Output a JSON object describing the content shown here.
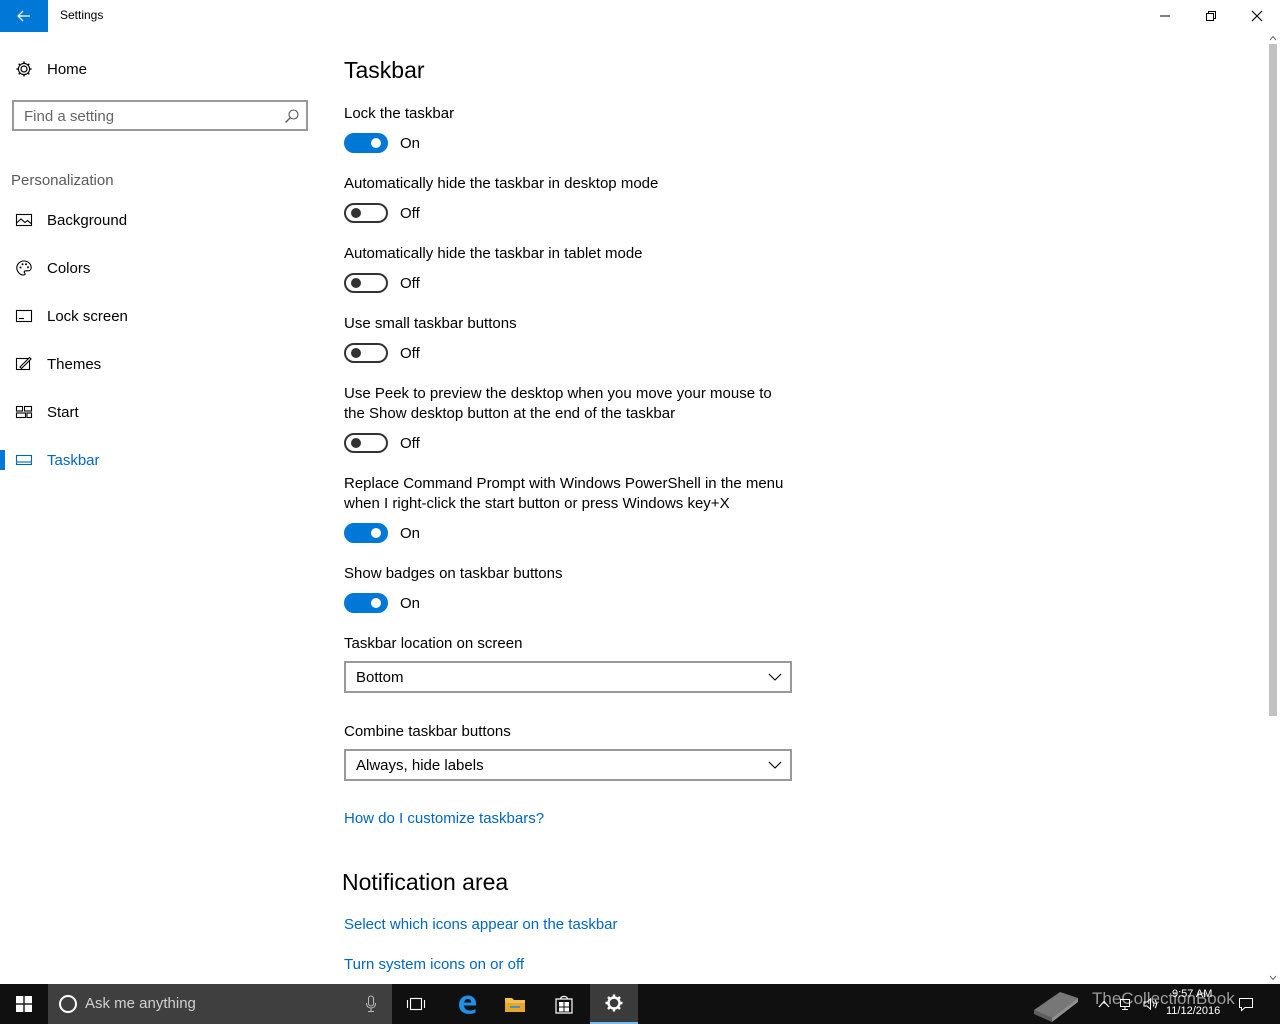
{
  "window": {
    "title": "Settings",
    "controls": [
      "minimize-icon",
      "restore-icon",
      "close-icon"
    ]
  },
  "sidebar": {
    "home_label": "Home",
    "search_placeholder": "Find a setting",
    "section_heading": "Personalization",
    "items": [
      {
        "label": "Background",
        "icon": "picture-icon",
        "active": false
      },
      {
        "label": "Colors",
        "icon": "palette-icon",
        "active": false
      },
      {
        "label": "Lock screen",
        "icon": "lock-screen-icon",
        "active": false
      },
      {
        "label": "Themes",
        "icon": "brush-icon",
        "active": false
      },
      {
        "label": "Start",
        "icon": "start-tiles-icon",
        "active": false
      },
      {
        "label": "Taskbar",
        "icon": "taskbar-icon",
        "active": true
      }
    ]
  },
  "main": {
    "title": "Taskbar",
    "options": [
      {
        "label": "Lock the taskbar",
        "state": "On",
        "on": true
      },
      {
        "label": "Automatically hide the taskbar in desktop mode",
        "state": "Off",
        "on": false
      },
      {
        "label": "Automatically hide the taskbar in tablet mode",
        "state": "Off",
        "on": false
      },
      {
        "label": "Use small taskbar buttons",
        "state": "Off",
        "on": false
      },
      {
        "label": "Use Peek to preview the desktop when you move your mouse to the Show desktop button at the end of the taskbar",
        "state": "Off",
        "on": false
      },
      {
        "label": "Replace Command Prompt with Windows PowerShell in the menu when I right-click the start button or press Windows key+X",
        "state": "On",
        "on": true
      },
      {
        "label": "Show badges on taskbar buttons",
        "state": "On",
        "on": true
      }
    ],
    "location": {
      "label": "Taskbar location on screen",
      "value": "Bottom"
    },
    "combine": {
      "label": "Combine taskbar buttons",
      "value": "Always, hide labels"
    },
    "help_link": "How do I customize taskbars?",
    "notification": {
      "title": "Notification area",
      "link1": "Select which icons appear on the taskbar",
      "link2": "Turn system icons on or off"
    }
  },
  "taskbar": {
    "search_placeholder": "Ask me anything",
    "apps": [
      "task-view-icon",
      "edge-icon",
      "file-explorer-icon",
      "store-icon",
      "settings-gear-icon"
    ],
    "watermark": "TheCollectionBook",
    "time": "9:57 AM",
    "date": "11/12/2016"
  },
  "colors": {
    "accent": "#0078d7",
    "link": "#0067c0",
    "taskbar": "#101010"
  }
}
